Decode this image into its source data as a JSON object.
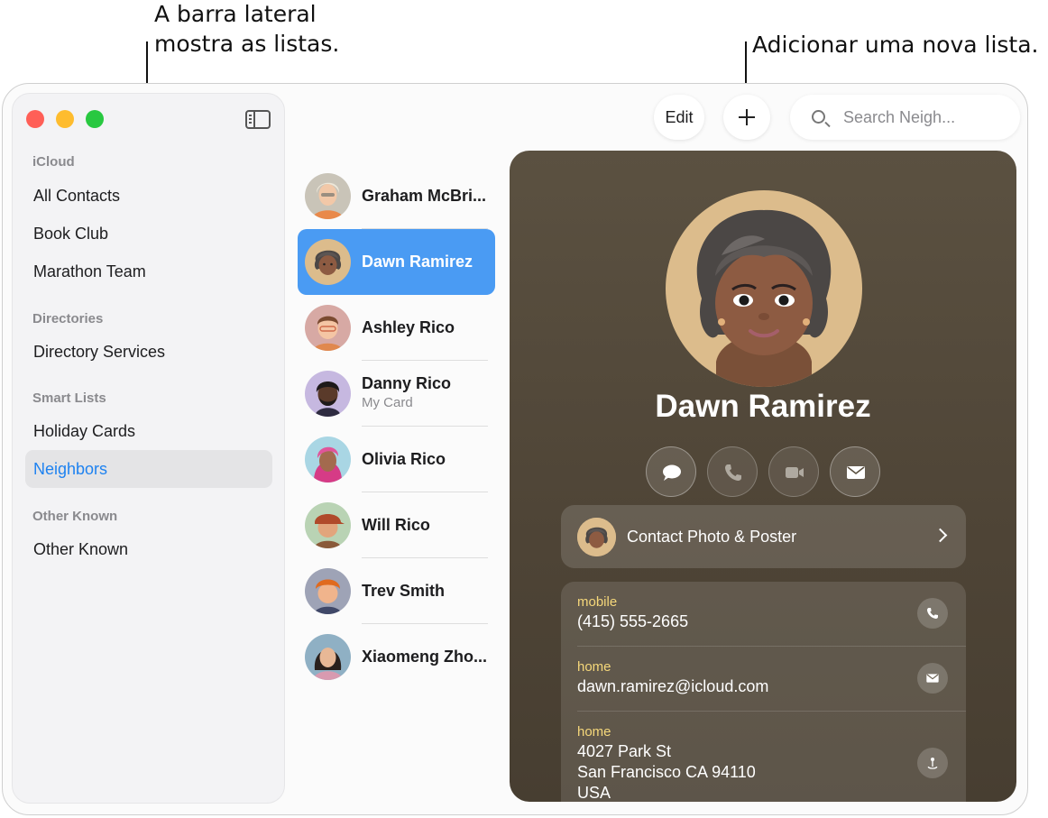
{
  "callouts": {
    "sidebar_line1": "A barra lateral",
    "sidebar_line2": "mostra as listas.",
    "add_list": "Adicionar uma nova lista."
  },
  "toolbar": {
    "edit_label": "Edit",
    "search_placeholder": "Search Neigh..."
  },
  "sidebar": {
    "sections": [
      {
        "heading": "iCloud",
        "items": [
          "All Contacts",
          "Book Club",
          "Marathon Team"
        ]
      },
      {
        "heading": "Directories",
        "items": [
          "Directory Services"
        ]
      },
      {
        "heading": "Smart Lists",
        "items": [
          "Holiday Cards",
          "Neighbors"
        ]
      },
      {
        "heading": "Other Known",
        "items": [
          "Other Known"
        ]
      }
    ],
    "selected": "Neighbors"
  },
  "contacts": [
    {
      "name": "Graham McBri...",
      "subtitle": ""
    },
    {
      "name": "Dawn Ramirez",
      "subtitle": ""
    },
    {
      "name": "Ashley Rico",
      "subtitle": ""
    },
    {
      "name": "Danny Rico",
      "subtitle": "My Card"
    },
    {
      "name": "Olivia Rico",
      "subtitle": ""
    },
    {
      "name": "Will Rico",
      "subtitle": ""
    },
    {
      "name": "Trev Smith",
      "subtitle": ""
    },
    {
      "name": "Xiaomeng Zho...",
      "subtitle": ""
    }
  ],
  "detail": {
    "name": "Dawn Ramirez",
    "actions": [
      "message-icon",
      "phone-icon",
      "video-icon",
      "mail-icon"
    ],
    "poster_label": "Contact Photo & Poster",
    "fields": [
      {
        "label": "mobile",
        "value": "(415) 555-2665",
        "icon": "phone-icon"
      },
      {
        "label": "home",
        "value": "dawn.ramirez@icloud.com",
        "icon": "mail-icon"
      },
      {
        "label": "home",
        "value_lines": [
          "4027 Park St",
          "San Francisco CA 94110",
          "USA"
        ],
        "icon": "map-pin-icon"
      }
    ]
  },
  "colors": {
    "accent": "#4a9bf3",
    "sidebar_selected_text": "#1e82f0",
    "card_background": "#5b5141",
    "field_label": "#f5d77a"
  }
}
